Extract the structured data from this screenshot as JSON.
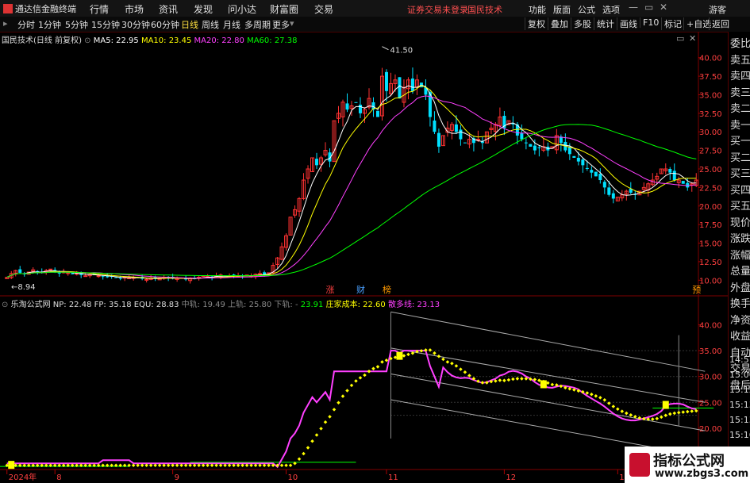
{
  "menubar": {
    "app_title": "通达信金融终端",
    "items": [
      "行情",
      "市场",
      "资讯",
      "发现",
      "问小达",
      "财富圈",
      "交易"
    ],
    "login_status": "证券交易未登录",
    "stock_name": "国民技术",
    "right_items": [
      "功能",
      "版面",
      "公式",
      "选项"
    ],
    "guest": "游客"
  },
  "toolbar": {
    "periods": [
      "分时",
      "1分钟",
      "5分钟",
      "15分钟",
      "30分钟",
      "60分钟",
      "日线",
      "周线",
      "月线",
      "多周期",
      "更多"
    ],
    "selected_period": "日线",
    "buttons": [
      "复权",
      "叠加",
      "多股",
      "统计",
      "画线",
      "F10",
      "标记",
      "+自选",
      "返回"
    ]
  },
  "main_panel": {
    "title": "国民技术(日线 前复权)",
    "ma": [
      {
        "label": "MA5: 22.95",
        "color": "#ffffff"
      },
      {
        "label": "MA10: 23.45",
        "color": "#ffff00"
      },
      {
        "label": "MA20: 22.80",
        "color": "#ff40ff"
      },
      {
        "label": "MA60: 27.38",
        "color": "#00ff00"
      }
    ],
    "high_label": "41.50",
    "low_label": "8.94",
    "markers": [
      {
        "text": "涨",
        "color": "#ff4040",
        "day": 74
      },
      {
        "text": "财",
        "color": "#4aa0ff",
        "day": 81
      },
      {
        "text": "榜",
        "color": "#ff9900",
        "day": 87
      },
      {
        "text": "预",
        "color": "#ff9900",
        "day": 158
      }
    ]
  },
  "sub_panel": {
    "title": "乐淘公式网",
    "values": [
      {
        "label": "NP: 22.48",
        "color": "#dddddd"
      },
      {
        "label": "FP: 35.18",
        "color": "#dddddd"
      },
      {
        "label": "EQU: 28.83",
        "color": "#dddddd"
      },
      {
        "label": "中轨: 19.49",
        "color": "#888888"
      },
      {
        "label": "上轨: 25.80",
        "color": "#888888"
      },
      {
        "label": "下轨: -",
        "color": "#888888"
      },
      {
        "label": "23.91",
        "color": "#00ff00"
      },
      {
        "label": "庄家成本: 22.60",
        "color": "#ffff00"
      },
      {
        "label": "散多线: 23.13",
        "color": "#ff40ff"
      }
    ]
  },
  "right_panel": {
    "items": [
      "委比",
      "卖五",
      "卖四",
      "卖三",
      "卖二",
      "卖一",
      "买一",
      "买二",
      "买三",
      "买四",
      "买五",
      "现价",
      "涨跌",
      "涨幅",
      "总量",
      "外盘",
      "换手",
      "净资",
      "收益",
      "自动",
      "交易",
      "盘后"
    ],
    "times": [
      "14:57",
      "15:00",
      "15:12",
      "15:13",
      "15:13",
      "15:16"
    ]
  },
  "watermark": {
    "line1": "指标公式网",
    "line2": "www.zbgs3.com"
  },
  "chart_data": {
    "type": "candlestick",
    "main_yticks": [
      "40.00",
      "37.50",
      "35.00",
      "32.50",
      "30.00",
      "27.50",
      "25.00",
      "22.50",
      "20.00",
      "17.50",
      "15.00",
      "12.50",
      "10.00"
    ],
    "main_ylim": [
      8.0,
      42.0
    ],
    "sub_yticks": [
      "40.00",
      "35.00",
      "30.00",
      "25.00",
      "20.00",
      "15.00"
    ],
    "sub_ylim": [
      12.0,
      43.0
    ],
    "x_labels": [
      {
        "text": "2024年",
        "day": 0
      },
      {
        "text": "8",
        "day": 11
      },
      {
        "text": "9",
        "day": 38
      },
      {
        "text": "10",
        "day": 64
      },
      {
        "text": "11",
        "day": 87
      },
      {
        "text": "12",
        "day": 114
      },
      {
        "text": "1",
        "day": 140
      }
    ],
    "closes": [
      10.4,
      10.9,
      11.3,
      11.0,
      10.8,
      11.1,
      11.4,
      11.2,
      11.0,
      11.3,
      11.5,
      11.2,
      10.9,
      11.1,
      11.0,
      10.8,
      10.9,
      10.7,
      10.6,
      10.8,
      10.7,
      10.6,
      10.5,
      10.4,
      10.5,
      10.3,
      10.2,
      10.4,
      10.3,
      10.4,
      10.3,
      10.2,
      10.1,
      10.3,
      10.2,
      10.3,
      10.4,
      10.3,
      10.2,
      10.3,
      10.2,
      10.1,
      10.3,
      10.2,
      10.4,
      10.6,
      10.5,
      10.4,
      10.6,
      10.7,
      10.5,
      10.6,
      10.7,
      10.6,
      10.5,
      10.7,
      10.6,
      10.8,
      10.9,
      10.8,
      11.0,
      12.0,
      13.0,
      14.5,
      16.0,
      18.5,
      19.5,
      21.0,
      23.5,
      25.0,
      26.5,
      25.5,
      26.5,
      27.5,
      26.0,
      31.5,
      32.5,
      34.0,
      33.0,
      33.5,
      34.0,
      32.5,
      33.0,
      34.5,
      33.0,
      32.0,
      37.5,
      35.5,
      36.5,
      37.0,
      34.5,
      36.0,
      37.0,
      35.5,
      37.0,
      36.0,
      35.0,
      32.0,
      30.0,
      28.0,
      29.5,
      30.5,
      31.0,
      30.0,
      29.0,
      28.5,
      29.0,
      28.5,
      29.0,
      28.5,
      30.0,
      30.5,
      31.0,
      32.0,
      30.5,
      31.5,
      31.0,
      29.5,
      29.0,
      28.5,
      28.0,
      27.5,
      27.8,
      28.0,
      27.5,
      28.0,
      29.5,
      28.5,
      27.5,
      27.0,
      26.5,
      26.0,
      25.5,
      25.0,
      24.5,
      24.0,
      23.5,
      22.5,
      21.5,
      21.0,
      21.2,
      21.5,
      22.0,
      21.8,
      21.5,
      22.0,
      22.5,
      23.0,
      23.5,
      24.0,
      25.0,
      25.0,
      24.5,
      23.5,
      23.5,
      23.0,
      22.5,
      23.0,
      23.5
    ],
    "main_series": [
      {
        "name": "MA5",
        "color": "#ffffff",
        "window": 5
      },
      {
        "name": "MA10",
        "color": "#ffff00",
        "window": 10
      },
      {
        "name": "MA20",
        "color": "#ff40ff",
        "window": 20
      },
      {
        "name": "MA60",
        "color": "#00ff00",
        "window": 60
      }
    ],
    "sub_series": [
      {
        "name": "乐淘公式网",
        "color": "#ffff00",
        "style": "dots"
      },
      {
        "name": "散多线",
        "color": "#ff40ff",
        "style": "line"
      }
    ],
    "channel_lines_color": "#aaaaaa"
  }
}
